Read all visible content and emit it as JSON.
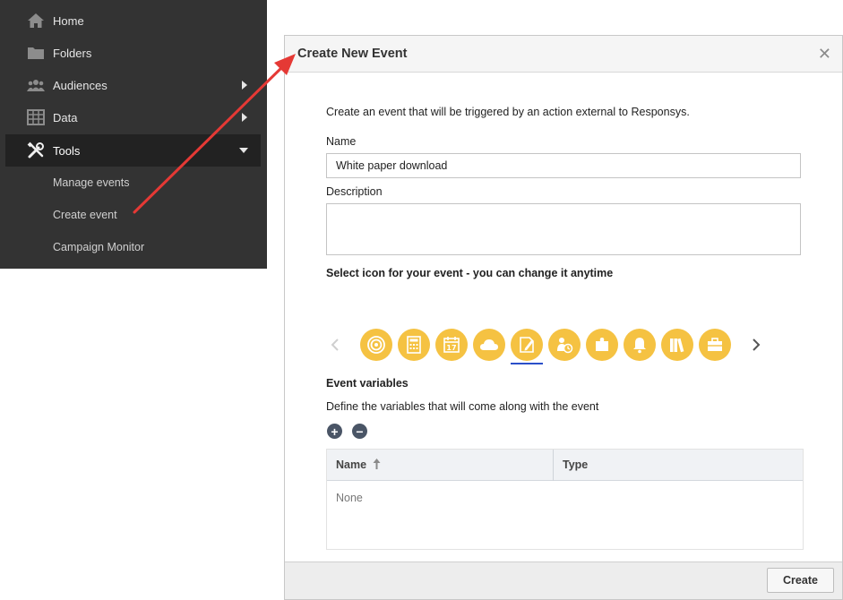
{
  "sidebar": {
    "items": [
      {
        "label": "Home",
        "icon": "home-icon"
      },
      {
        "label": "Folders",
        "icon": "folder-icon"
      },
      {
        "label": "Audiences",
        "icon": "audiences-icon",
        "has_submenu": true
      },
      {
        "label": "Data",
        "icon": "data-grid-icon",
        "has_submenu": true
      },
      {
        "label": "Tools",
        "icon": "tools-icon",
        "expanded": true
      }
    ],
    "sub_items": [
      {
        "label": "Manage events"
      },
      {
        "label": "Create event"
      },
      {
        "label": "Campaign Monitor"
      }
    ]
  },
  "dialog": {
    "title": "Create New Event",
    "intro": "Create an event that will be triggered by an action external to Responsys.",
    "name_label": "Name",
    "name_value": "White paper download",
    "description_label": "Description",
    "description_value": "",
    "icon_section_title": "Select icon for your event - you can change it anytime",
    "icons": [
      "target-icon",
      "calculator-icon",
      "calendar-icon",
      "cloud-icon",
      "note-icon",
      "person-clock-icon",
      "puzzle-icon",
      "bell-icon",
      "books-icon",
      "briefcase-icon"
    ],
    "selected_icon_index": 4,
    "variables_title": "Event variables",
    "variables_desc": "Define the variables that will come along with the event",
    "table": {
      "columns": [
        "Name",
        "Type"
      ],
      "empty_text": "None"
    },
    "create_label": "Create"
  },
  "colors": {
    "sidebar_bg": "#333333",
    "icon_bg": "#f5c242",
    "annotation_arrow": "#e53935",
    "selection_underline": "#2b4fc9"
  }
}
